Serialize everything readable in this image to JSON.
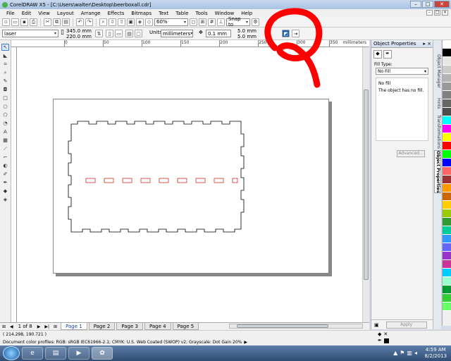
{
  "window": {
    "title": "CorelDRAW X5 - [C:\\Users\\walter\\Desktop\\beerboxall.cdr]",
    "controls": [
      "–",
      "□",
      "✕"
    ]
  },
  "menu": {
    "items": [
      "File",
      "Edit",
      "View",
      "Layout",
      "Arrange",
      "Effects",
      "Bitmaps",
      "Text",
      "Table",
      "Tools",
      "Window",
      "Help"
    ]
  },
  "standard_toolbar": {
    "zoom_level": "60%",
    "snap_to": "Snap to"
  },
  "property_bar": {
    "preset": "laser",
    "width": "345.0 mm",
    "height": "220.0 mm",
    "units_label": "Units:",
    "units": "millimeters",
    "nudge": "0.1 mm",
    "duplicate_x": "5.0 mm",
    "duplicate_y": "5.0 mm"
  },
  "ruler": {
    "ticks": [
      "0",
      "50",
      "100",
      "150",
      "200",
      "250",
      "300",
      "350"
    ],
    "unit": "millimeters"
  },
  "docker": {
    "title": "Object Properties",
    "fill_type_label": "Fill Type:",
    "fill_type_value": "No Fill",
    "fill_name": "No fill",
    "fill_desc": "The object has no fill.",
    "advanced_label": "Advanced...",
    "apply_label": "Apply"
  },
  "docker_tabs": [
    "Object Manager",
    "Hints",
    "Transformations",
    "Object Properties"
  ],
  "palette_colors": [
    "#ffffff",
    "#000000",
    "#e6e6e6",
    "#cccccc",
    "#b3b3b3",
    "#999999",
    "#808080",
    "#666666",
    "#4d4d4d",
    "#00ffff",
    "#ff00ff",
    "#ffff00",
    "#ff0000",
    "#00ff00",
    "#0000ff",
    "#ff6666",
    "#993333",
    "#ff9900",
    "#cc6600",
    "#ffcc00",
    "#99cc00",
    "#339933",
    "#00cc99",
    "#3399ff",
    "#6666ff",
    "#9933cc",
    "#cc3399",
    "#00ccff",
    "#99ffcc",
    "#009933",
    "#33cc33",
    "#66ff66"
  ],
  "pages": {
    "counter": "1 of 8",
    "tabs": [
      "Page 1",
      "Page 2",
      "Page 3",
      "Page 4",
      "Page 5"
    ]
  },
  "status": {
    "coords": "( 214.298, 190.721 )",
    "color_profiles": "Document color profiles: RGB: sRGB IEC61966-2.1; CMYK: U.S. Web Coated (SWOP) v2; Grayscale: Dot Gain 20%"
  },
  "taskbar": {
    "time": "4:59 AM",
    "date": "8/2/2013"
  },
  "colors": {
    "annotation": "#ff0000",
    "cut_line": "#d62828"
  }
}
